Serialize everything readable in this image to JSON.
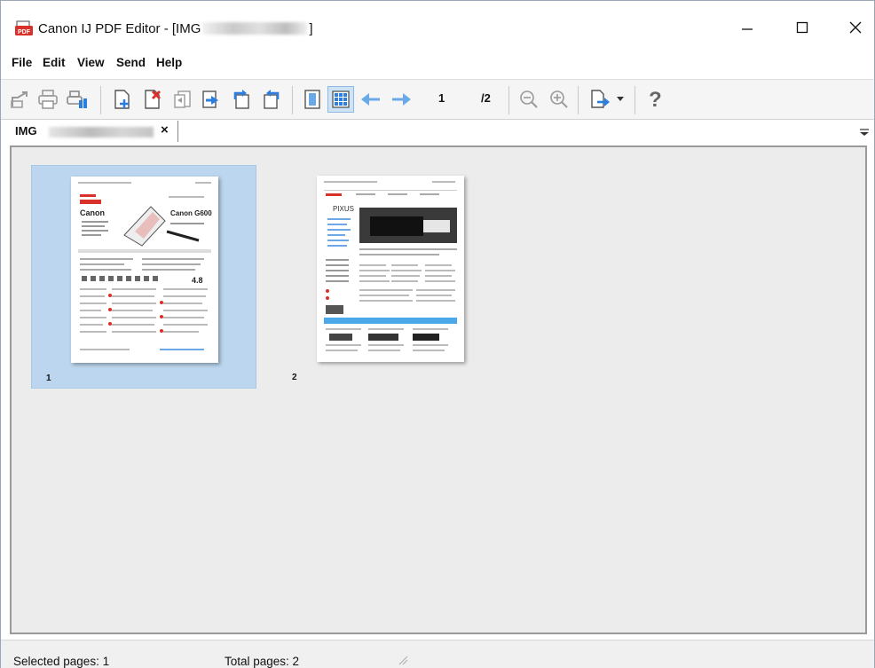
{
  "window": {
    "title_prefix": "Canon IJ PDF Editor - [IMG",
    "title_suffix": "]",
    "minimize_icon": "minimize-icon",
    "maximize_icon": "maximize-icon",
    "close_icon": "close-icon"
  },
  "menu": {
    "items": [
      "File",
      "Edit",
      "View",
      "Send",
      "Help"
    ]
  },
  "toolbar": {
    "current_page": "1",
    "total_pages": "/2",
    "buttons": [
      "import-icon",
      "print-icon",
      "scan-settings-icon",
      "add-page-icon",
      "delete-page-icon",
      "move-page-left-icon",
      "move-page-right-icon",
      "rotate-left-icon",
      "rotate-right-icon",
      "page-view-icon",
      "thumbnail-view-icon",
      "previous-page-icon",
      "next-page-icon",
      "zoom-out-icon",
      "zoom-in-icon",
      "export-icon",
      "help-icon"
    ]
  },
  "tab": {
    "label": "IMG",
    "close": "×"
  },
  "pages": [
    {
      "number": "1",
      "selected": true
    },
    {
      "number": "2",
      "selected": false
    }
  ],
  "status": {
    "selected": "Selected pages: 1",
    "total": "Total pages: 2"
  },
  "colors": {
    "selection": "#bcd6ef",
    "toolbar_blue": "#2b7de0",
    "accent_red": "#d9302a"
  }
}
